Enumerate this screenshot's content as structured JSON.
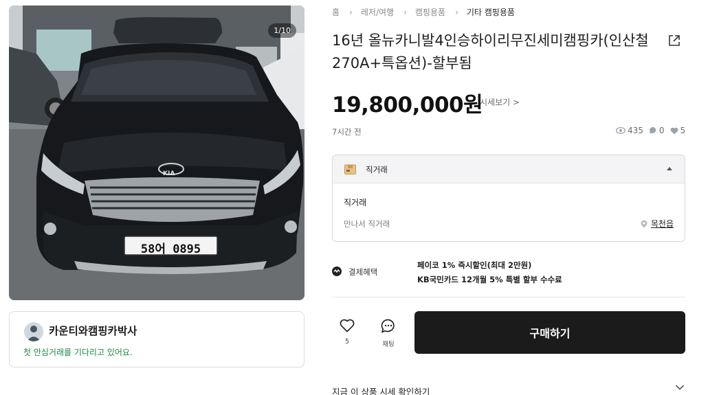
{
  "gallery": {
    "counter": "1/10",
    "plate": "58어 0895",
    "logo": "KIA"
  },
  "seller": {
    "name": "카운티와캠핑카박사",
    "message": "첫 안심거래를 기다리고 있어요."
  },
  "breadcrumb": [
    "홈",
    "레저/여행",
    "캠핑용품",
    "기타 캠핑용품"
  ],
  "product": {
    "title": "16년 올뉴카니발4인승하이리무진세미캠핑카(인산철270A+특옵션)-할부됨",
    "price": "19,800,000원",
    "detail_link": "시세보기 >",
    "posted": "7시간 전",
    "views": "435",
    "chats": "0",
    "likes": "5"
  },
  "trade": {
    "header": "직거래",
    "title": "직거래",
    "subtitle": "만나서 직거래",
    "location": "목천읍"
  },
  "payment": {
    "label": "결제혜택",
    "line1": "페이코 1% 즉시할인(최대 2만원)",
    "line2": "KB국민카드 12개월 5% 특별 할부 수수료"
  },
  "actions": {
    "like_count": "5",
    "chat_label": "채팅",
    "buy_label": "구매하기"
  },
  "confirm": {
    "label": "지금 이 상품 시세 확인하기"
  },
  "colors": {
    "buy_button": "#1b1b1b",
    "seller_message": "#1c8a3e"
  },
  "icons": [
    "share-icon",
    "eye-icon",
    "chat-bubble-icon",
    "heart-icon",
    "box-icon",
    "location-pin-icon",
    "pay-icon",
    "chevron-down-icon"
  ]
}
